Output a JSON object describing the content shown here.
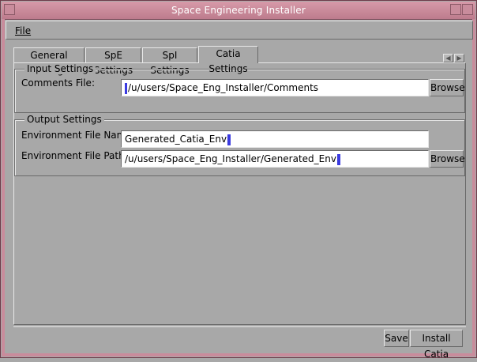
{
  "window": {
    "title": "Space Engineering Installer"
  },
  "menu": {
    "file": "File"
  },
  "tabs": [
    {
      "label": "General Settings"
    },
    {
      "label": "SpE Settings"
    },
    {
      "label": "SpI Settings"
    },
    {
      "label": "Catia Settings"
    }
  ],
  "input_settings": {
    "legend": "Input Settings",
    "comments_label": "Comments File:",
    "comments_value": "/u/users/Space_Eng_Installer/Comments",
    "browse": "Browse"
  },
  "output_settings": {
    "legend": "Output Settings",
    "env_name_label": "Environment File Name:",
    "env_name_value": "Generated_Catia_Env",
    "env_path_label": "Environment File Path:",
    "env_path_value": "/u/users/Space_Eng_Installer/Generated_Env",
    "browse": "Browse"
  },
  "footer": {
    "save": "Save",
    "install": "Install Catia"
  },
  "colors": {
    "titlebar": "#c98c9c",
    "face": "#a8a8a8",
    "caret": "#3a3ae0"
  },
  "icons": {
    "scroll_left": "triangle-left",
    "scroll_right": "triangle-right"
  }
}
